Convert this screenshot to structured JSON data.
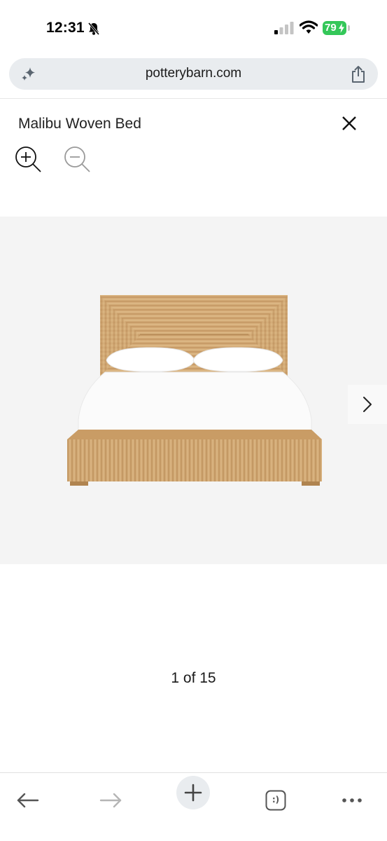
{
  "status_bar": {
    "time": "12:31",
    "battery": "79",
    "bell_icon": "bell-slash-icon",
    "battery_color": "#34c759"
  },
  "browser": {
    "url": "potterybarn.com",
    "left_icon": "sparkle-icon",
    "right_icon": "share-icon"
  },
  "viewer": {
    "title": "Malibu Woven Bed",
    "close_icon": "close-icon",
    "zoom_in_icon": "zoom-in-icon",
    "zoom_out_icon": "zoom-out-icon",
    "next_icon": "chevron-right-icon",
    "image_alt": "Malibu Woven Bed",
    "counter": "1 of 15"
  },
  "toolbar": {
    "icons": [
      "back-arrow-icon",
      "forward-arrow-icon",
      "new-tab-plus-icon",
      "tabs-icon",
      "more-icon"
    ],
    "tabs_label": ":)"
  }
}
